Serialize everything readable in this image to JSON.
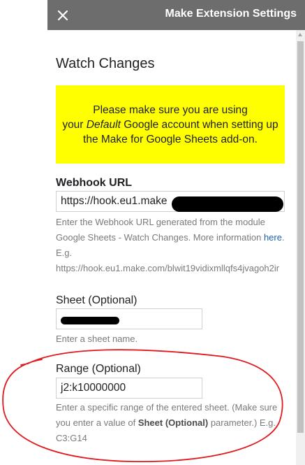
{
  "header": {
    "title": "Make Extension Settings",
    "close_icon": "close-icon"
  },
  "section_title": "Watch Changes",
  "notice": {
    "line1": "Please make sure you are using",
    "line2_pre": "your ",
    "line2_em": "Default",
    "line2_post": " Google account when setting up",
    "line3": "the Make for Google Sheets add-on.",
    "background": "#ffff00"
  },
  "webhook": {
    "label": "Webhook URL",
    "value": "https://hook.eu1.make",
    "help_pre": "Enter the Webhook URL generated from the module Google Sheets - Watch Changes. More information ",
    "help_link": "here",
    "help_post": ". E.g. https://hook.eu1.make.com/blwit19vidixmllqfs4jvagoh2ir"
  },
  "sheet": {
    "label": "Sheet (Optional)",
    "value": "",
    "help": "Enter a sheet name."
  },
  "range": {
    "label": "Range (Optional)",
    "value": "j2:k10000000",
    "help_pre": "Enter a specific range of the entered sheet. (Make sure you enter a value of ",
    "help_bold": "Sheet (Optional)",
    "help_post": " parameter.) E.g. C3:G14"
  },
  "colors": {
    "header_bg": "#6d6d6d",
    "link": "#1a5fb4",
    "annotation": "#e0191e"
  }
}
